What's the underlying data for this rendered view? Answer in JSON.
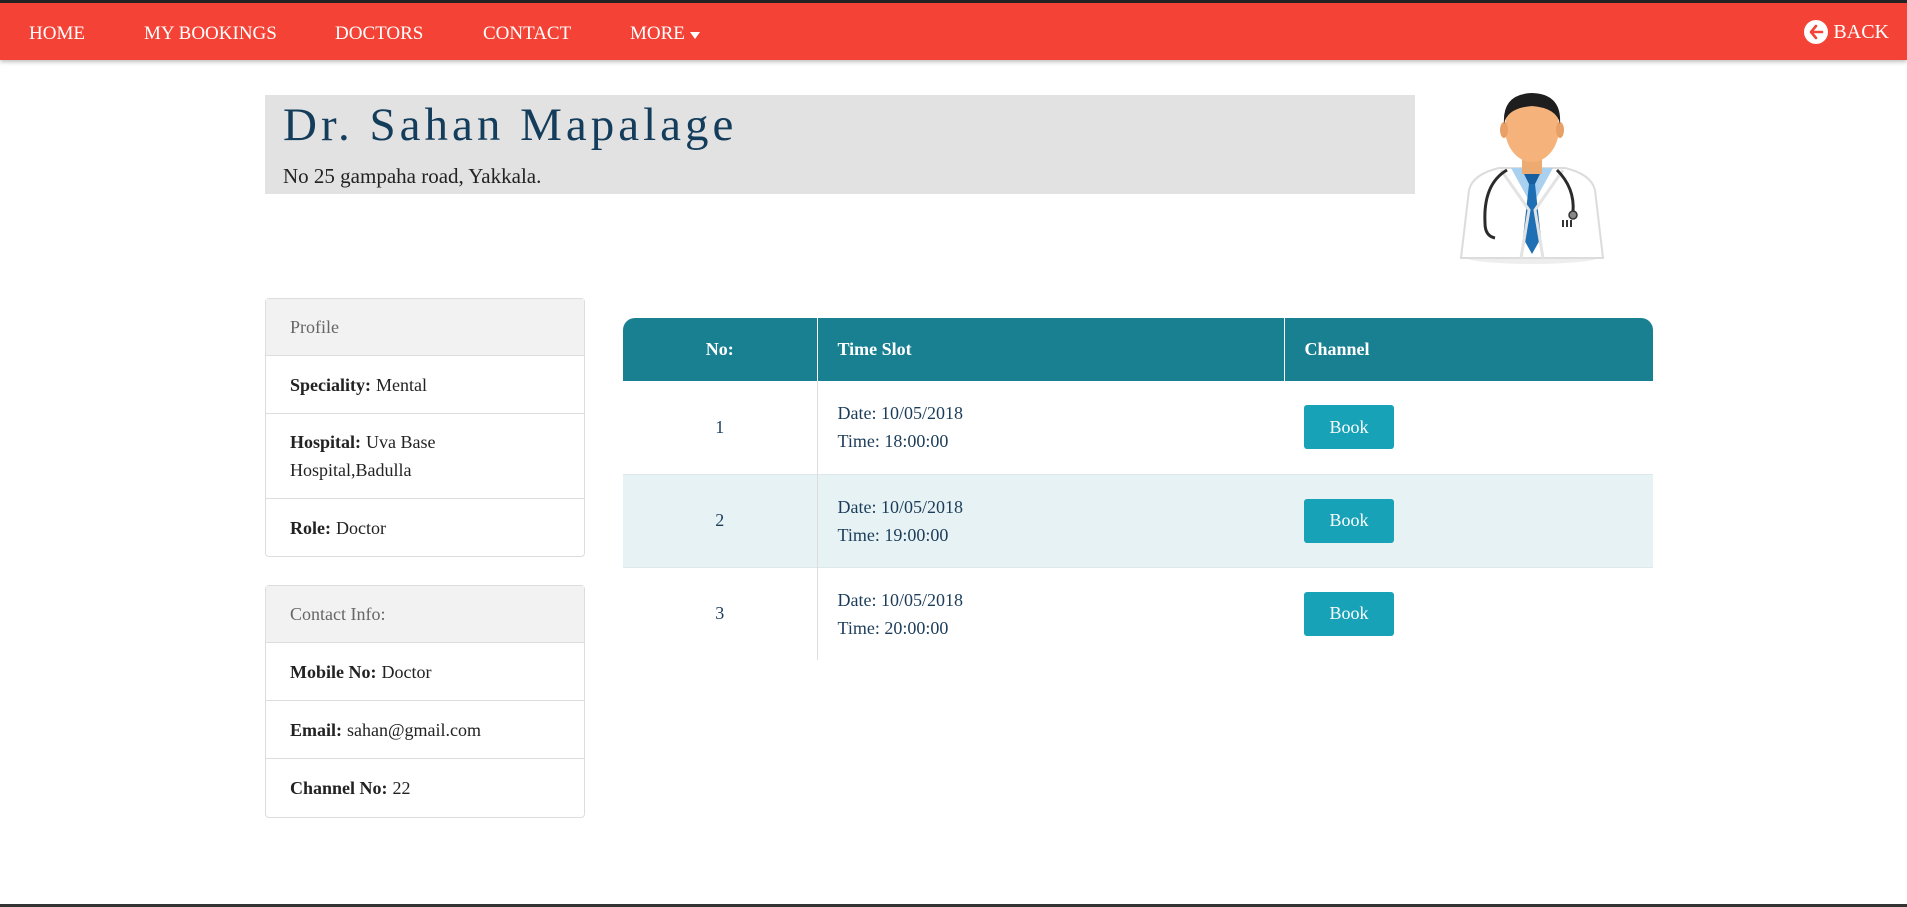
{
  "nav": {
    "items": [
      {
        "label": "HOME"
      },
      {
        "label": "MY BOOKINGS"
      },
      {
        "label": "DOCTORS"
      },
      {
        "label": "CONTACT"
      },
      {
        "label": "MORE"
      }
    ],
    "back_label": "BACK"
  },
  "doctor": {
    "name": "Dr. Sahan Mapalage",
    "address": "No 25 gampaha road, Yakkala."
  },
  "profile": {
    "header": "Profile",
    "speciality_label": "Speciality:",
    "speciality": "Mental",
    "hospital_label": "Hospital:",
    "hospital": "Uva Base Hospital,Badulla",
    "role_label": "Role:",
    "role": "Doctor"
  },
  "contact": {
    "header": "Contact Info:",
    "mobile_label": "Mobile No:",
    "mobile": "Doctor",
    "email_label": "Email:",
    "email": "sahan@gmail.com",
    "channel_label": "Channel No:",
    "channel": "22"
  },
  "table": {
    "headers": {
      "no": "No:",
      "slot": "Time Slot",
      "channel": "Channel"
    },
    "rows": [
      {
        "no": "1",
        "date": "Date: 10/05/2018",
        "time": "Time: 18:00:00",
        "button": "Book"
      },
      {
        "no": "2",
        "date": "Date: 10/05/2018",
        "time": "Time: 19:00:00",
        "button": "Book"
      },
      {
        "no": "3",
        "date": "Date: 10/05/2018",
        "time": "Time: 20:00:00",
        "button": "Book"
      }
    ]
  },
  "colors": {
    "navbar": "#f44336",
    "table_header": "#198092",
    "button": "#17a2b8"
  },
  "icons": {
    "back": "arrow-left-circle-icon",
    "more": "caret-down-icon",
    "avatar": "doctor-avatar"
  }
}
